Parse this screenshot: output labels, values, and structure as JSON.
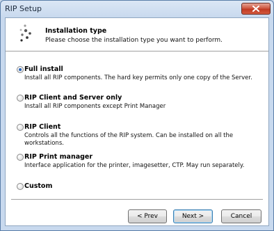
{
  "window": {
    "title": "RIP Setup"
  },
  "header": {
    "title": "Installation type",
    "subtitle": "Please choose the installation type you want to perform."
  },
  "options": [
    {
      "label": "Full install",
      "description": "Install all RIP components. The hard key permits only one copy of the Server.",
      "selected": true
    },
    {
      "label": "RIP Client and Server only",
      "description": "Install all RIP components except Print Manager",
      "selected": false
    },
    {
      "label": "RIP Client",
      "description": "Controls all the functions of the RIP system. Can be installed on all the workstations.",
      "selected": false
    },
    {
      "label": "RIP Print manager",
      "description": "Interface application for the printer, imagesetter, CTP. May run separately.",
      "selected": false
    },
    {
      "label": "Custom",
      "description": "",
      "selected": false
    }
  ],
  "buttons": {
    "prev": "< Prev",
    "next": "Next >",
    "cancel": "Cancel"
  },
  "icons": {
    "close": "close-icon",
    "header": "dots-logo-icon"
  },
  "colors": {
    "titlebar": "#c8d9ee",
    "close_button": "#c03a23",
    "radio_selected": "#2a64b8",
    "default_button_border": "#3c7fb1"
  }
}
